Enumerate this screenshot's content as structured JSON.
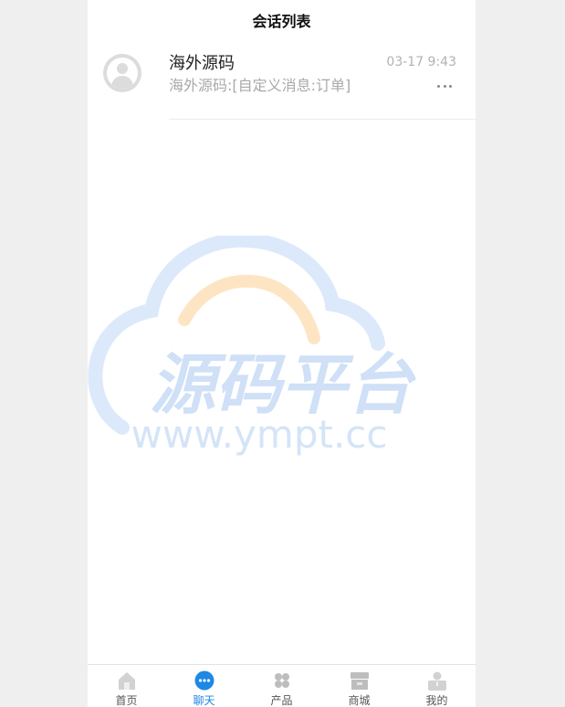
{
  "header": {
    "title": "会话列表"
  },
  "conversations": [
    {
      "name": "海外源码",
      "preview": "海外源码:[自定义消息:订单]",
      "time": "03-17 9:43",
      "avatar_icon": "default-user-avatar-icon",
      "more_icon": "more-dots-icon"
    }
  ],
  "watermark": {
    "title": "源码平台",
    "url": "www.ympt.cc",
    "text_color": "#cfe0f7",
    "arc_color": "#fde5c4"
  },
  "tabbar": {
    "active_color": "#1e88e5",
    "items": [
      {
        "label": "首页",
        "icon": "home-icon",
        "active": false
      },
      {
        "label": "聊天",
        "icon": "chat-bubble-icon",
        "active": true
      },
      {
        "label": "产品",
        "icon": "grid-icon",
        "active": false
      },
      {
        "label": "商城",
        "icon": "store-icon",
        "active": false
      },
      {
        "label": "我的",
        "icon": "user-icon",
        "active": false
      }
    ]
  }
}
